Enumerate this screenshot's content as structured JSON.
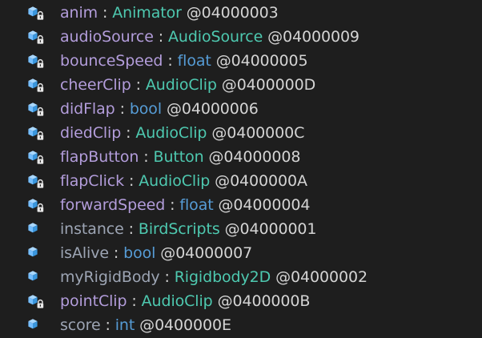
{
  "colors": {
    "background": "#1e1e1e",
    "field_name_private": "#b39ddb",
    "field_name_public": "#9da5b4",
    "type_class": "#4ec9b0",
    "type_keyword": "#569cd6",
    "text": "#d4d4d4",
    "icon_cube": "#75beff"
  },
  "fields": [
    {
      "name": "anim",
      "sep": " : ",
      "type": "Animator",
      "token": " @04000003",
      "icon": "field-private-icon",
      "private": true,
      "keyword": false
    },
    {
      "name": "audioSource",
      "sep": " : ",
      "type": "AudioSource",
      "token": " @04000009",
      "icon": "field-private-icon",
      "private": true,
      "keyword": false
    },
    {
      "name": "bounceSpeed",
      "sep": " : ",
      "type": "float",
      "token": " @04000005",
      "icon": "field-private-icon",
      "private": true,
      "keyword": true
    },
    {
      "name": "cheerClip",
      "sep": " : ",
      "type": "AudioClip",
      "token": " @0400000D",
      "icon": "field-private-icon",
      "private": true,
      "keyword": false
    },
    {
      "name": "didFlap",
      "sep": " : ",
      "type": "bool",
      "token": " @04000006",
      "icon": "field-private-icon",
      "private": true,
      "keyword": true
    },
    {
      "name": "diedClip",
      "sep": " : ",
      "type": "AudioClip",
      "token": " @0400000C",
      "icon": "field-private-icon",
      "private": true,
      "keyword": false
    },
    {
      "name": "flapButton",
      "sep": " : ",
      "type": "Button",
      "token": " @04000008",
      "icon": "field-private-icon",
      "private": true,
      "keyword": false
    },
    {
      "name": "flapClick",
      "sep": " : ",
      "type": "AudioClip",
      "token": " @0400000A",
      "icon": "field-private-icon",
      "private": true,
      "keyword": false
    },
    {
      "name": "forwardSpeed",
      "sep": " : ",
      "type": "float",
      "token": " @04000004",
      "icon": "field-private-icon",
      "private": true,
      "keyword": true
    },
    {
      "name": "instance",
      "sep": " : ",
      "type": "BirdScripts",
      "token": " @04000001",
      "icon": "field-public-icon",
      "private": false,
      "keyword": false
    },
    {
      "name": "isAlive",
      "sep": " : ",
      "type": "bool",
      "token": " @04000007",
      "icon": "field-public-icon",
      "private": false,
      "keyword": true
    },
    {
      "name": "myRigidBody",
      "sep": " : ",
      "type": "Rigidbody2D",
      "token": " @04000002",
      "icon": "field-public-icon",
      "private": false,
      "keyword": false
    },
    {
      "name": "pointClip",
      "sep": " : ",
      "type": "AudioClip",
      "token": " @0400000B",
      "icon": "field-private-icon",
      "private": true,
      "keyword": false
    },
    {
      "name": "score",
      "sep": " : ",
      "type": "int",
      "token": " @0400000E",
      "icon": "field-public-icon",
      "private": false,
      "keyword": true
    }
  ]
}
